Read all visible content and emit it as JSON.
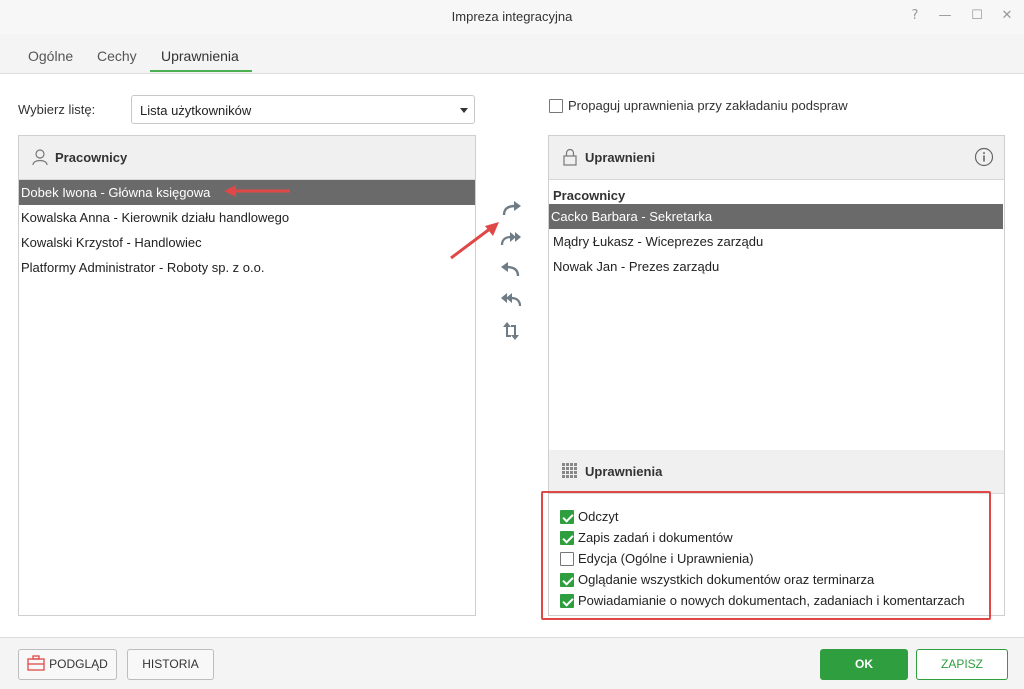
{
  "window": {
    "title": "Impreza integracyjna",
    "help": "?",
    "minimize": "—",
    "maximize": "☐",
    "close": "✕"
  },
  "tabs": [
    {
      "label": "Ogólne"
    },
    {
      "label": "Cechy"
    },
    {
      "label": "Uprawnienia",
      "active": true
    }
  ],
  "list_selector": {
    "label": "Wybierz listę:",
    "value": "Lista użytkowników"
  },
  "propagate": {
    "label": "Propaguj uprawnienia przy zakładaniu podspraw",
    "checked": false
  },
  "left_panel": {
    "title": "Pracownicy",
    "icon": "user-icon",
    "items": [
      {
        "label": "Dobek Iwona - Główna księgowa",
        "selected": true
      },
      {
        "label": "Kowalska Anna - Kierownik działu handlowego"
      },
      {
        "label": "Kowalski Krzystof - Handlowiec"
      },
      {
        "label": "Platformy Administrator - Roboty sp. z o.o."
      }
    ]
  },
  "transfer_buttons": [
    "move-right-icon",
    "move-all-right-icon",
    "move-left-icon",
    "move-all-left-icon",
    "swap-icon"
  ],
  "right_panel": {
    "title": "Uprawnieni",
    "icon": "lock-icon",
    "info_icon": "info-icon",
    "group": "Pracownicy",
    "items": [
      {
        "label": "Cacko Barbara - Sekretarka",
        "selected": true
      },
      {
        "label": "Mądry Łukasz - Wiceprezes zarządu"
      },
      {
        "label": "Nowak Jan - Prezes zarządu"
      }
    ]
  },
  "permissions_panel": {
    "title": "Uprawnienia",
    "icon": "grid-icon",
    "items": [
      {
        "label": "Odczyt",
        "checked": true
      },
      {
        "label": "Zapis zadań i dokumentów",
        "checked": true
      },
      {
        "label": "Edycja (Ogólne i Uprawnienia)",
        "checked": false
      },
      {
        "label": "Oglądanie wszystkich dokumentów oraz terminarza",
        "checked": true
      },
      {
        "label": "Powiadamianie o nowych dokumentach, zadaniach i komentarzach",
        "checked": true
      }
    ]
  },
  "footer": {
    "preview": "PODGLĄD",
    "history": "HISTORIA",
    "ok": "OK",
    "save": "ZAPISZ"
  },
  "colors": {
    "accent_green": "#2e9e3e",
    "annotation_red": "#e04848",
    "selection_gray": "#6a6a6a"
  }
}
